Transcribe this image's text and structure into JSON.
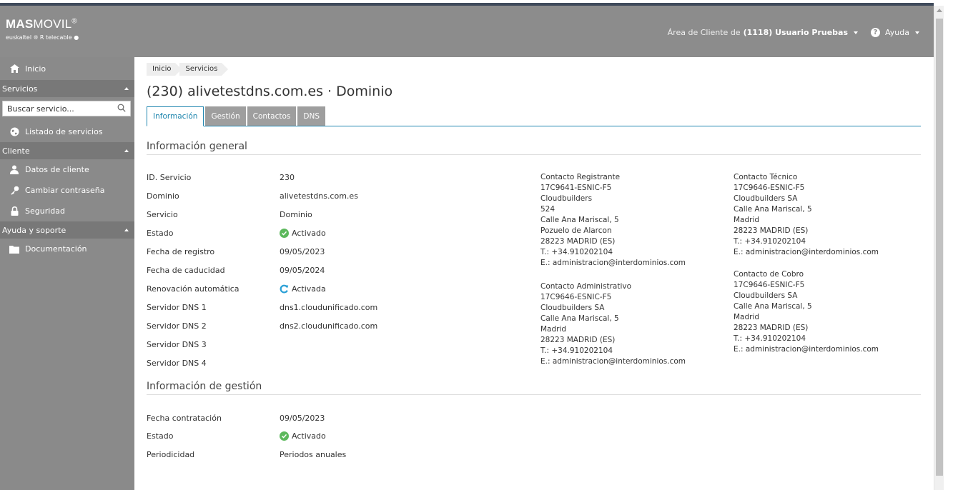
{
  "header": {
    "brand_bold": "MAS",
    "brand_light": "MOVIL",
    "brand_reg": "®",
    "sub_brands": "euskaltel ❊ R telecable ●",
    "area_label": "Área de Cliente de",
    "user": "(1118) Usuario Pruebas",
    "help": "Ayuda"
  },
  "sidebar": {
    "home": "Inicio",
    "section_services": "Servicios",
    "search_placeholder": "Buscar servicio...",
    "services_list": "Listado de servicios",
    "section_client": "Cliente",
    "client_data": "Datos de cliente",
    "change_password": "Cambiar contraseña",
    "security": "Seguridad",
    "section_help": "Ayuda y soporte",
    "docs": "Documentación"
  },
  "breadcrumb": [
    "Inicio",
    "Servicios"
  ],
  "page_title": "(230) alivetestdns.com.es · Dominio",
  "tabs": [
    "Información",
    "Gestión",
    "Contactos",
    "DNS"
  ],
  "general": {
    "title": "Información general",
    "rows": [
      {
        "k": "ID. Servicio",
        "v": "230"
      },
      {
        "k": "Dominio",
        "v": "alivetestdns.com.es"
      },
      {
        "k": "Servicio",
        "v": "Dominio"
      },
      {
        "k": "Estado",
        "v": "Activado"
      },
      {
        "k": "Fecha de registro",
        "v": "09/05/2023"
      },
      {
        "k": "Fecha de caducidad",
        "v": "09/05/2024"
      },
      {
        "k": "Renovación automática",
        "v": "Activada"
      },
      {
        "k": "Servidor DNS 1",
        "v": "dns1.cloudunificado.com"
      },
      {
        "k": "Servidor DNS 2",
        "v": "dns2.cloudunificado.com"
      },
      {
        "k": "Servidor DNS 3",
        "v": ""
      },
      {
        "k": "Servidor DNS 4",
        "v": ""
      }
    ]
  },
  "contacts": {
    "registrant": [
      "Contacto Registrante",
      "17C9641-ESNIC-F5",
      "Cloudbuilders",
      "524",
      "Calle Ana Mariscal, 5",
      "Pozuelo de Alarcon",
      "28223 MADRID (ES)",
      "T.: +34.910202104",
      "E.: administracion@interdominios.com"
    ],
    "admin": [
      "Contacto Administrativo",
      "17C9646-ESNIC-F5",
      "Cloudbuilders SA",
      "Calle Ana Mariscal, 5",
      "Madrid",
      "28223 MADRID (ES)",
      "T.: +34.910202104",
      "E.: administracion@interdominios.com"
    ],
    "tech": [
      "Contacto Técnico",
      "17C9646-ESNIC-F5",
      "Cloudbuilders SA",
      "Calle Ana Mariscal, 5",
      "Madrid",
      "28223 MADRID (ES)",
      "T.: +34.910202104",
      "E.: administracion@interdominios.com"
    ],
    "billing": [
      "Contacto de Cobro",
      "17C9646-ESNIC-F5",
      "Cloudbuilders SA",
      "Calle Ana Mariscal, 5",
      "Madrid",
      "28223 MADRID (ES)",
      "T.: +34.910202104",
      "E.: administracion@interdominios.com"
    ]
  },
  "management": {
    "title": "Información de gestión",
    "rows": [
      {
        "k": "Fecha contratación",
        "v": "09/05/2023"
      },
      {
        "k": "Estado",
        "v": "Activado"
      },
      {
        "k": "Periodicidad",
        "v": "Periodos anuales"
      }
    ]
  },
  "colors": {
    "accent": "#2186b0",
    "sidebar": "#8a8a8a",
    "header": "#8c8c8c",
    "ok": "#5cb85c"
  }
}
